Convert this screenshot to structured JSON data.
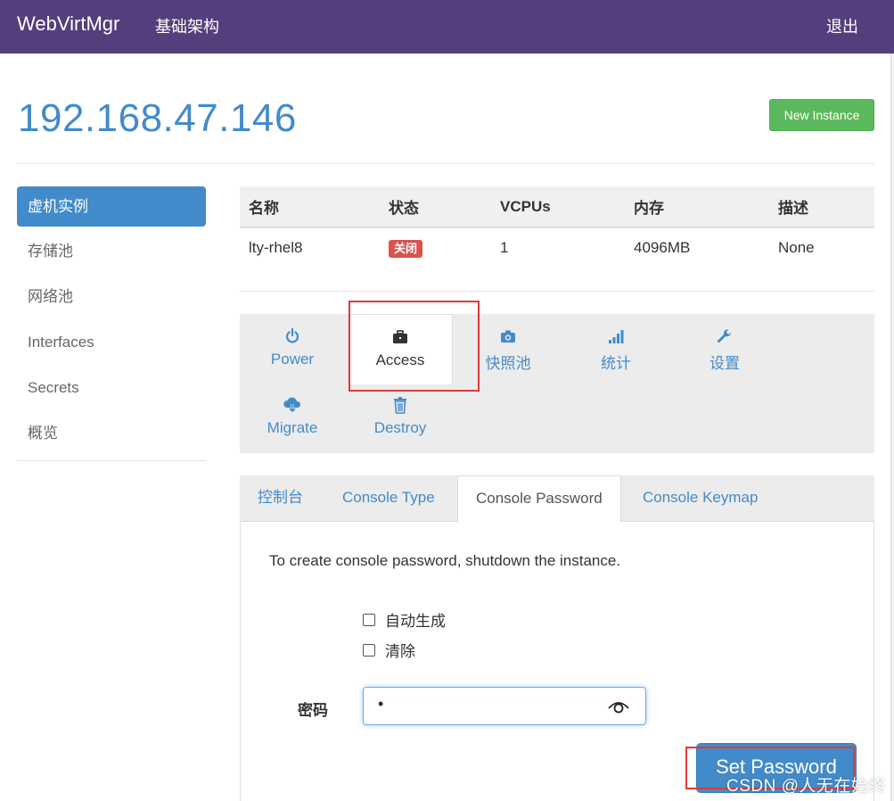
{
  "navbar": {
    "brand": "WebVirtMgr",
    "link": "基础架构",
    "logout": "退出",
    "bg_color": "#563d7c"
  },
  "header": {
    "title": "192.168.47.146",
    "new_instance_label": "New Instance"
  },
  "sidebar": {
    "items": [
      {
        "label": "虚机实例",
        "active": true
      },
      {
        "label": "存储池"
      },
      {
        "label": "网络池"
      },
      {
        "label": "Interfaces"
      },
      {
        "label": "Secrets"
      },
      {
        "label": "概览"
      }
    ]
  },
  "table": {
    "headers": [
      "名称",
      "状态",
      "VCPUs",
      "内存",
      "描述"
    ],
    "row": {
      "name": "lty-rhel8",
      "status": "关闭",
      "vcpus": "1",
      "memory": "4096MB",
      "desc": "None"
    }
  },
  "actions": [
    {
      "label": "Power",
      "icon": "power-icon"
    },
    {
      "label": "Access",
      "icon": "briefcase-icon",
      "selected": true
    },
    {
      "label": "快照池",
      "icon": "camera-icon"
    },
    {
      "label": "统计",
      "icon": "signal-icon"
    },
    {
      "label": "设置",
      "icon": "wrench-icon"
    },
    {
      "label": "Migrate",
      "icon": "cloud-download-icon"
    },
    {
      "label": "Destroy",
      "icon": "trash-icon"
    }
  ],
  "subtabs": [
    {
      "label": "控制台"
    },
    {
      "label": "Console Type"
    },
    {
      "label": "Console Password",
      "active": true
    },
    {
      "label": "Console Keymap"
    }
  ],
  "console_password": {
    "info": "To create console password, shutdown the instance.",
    "checkbox_auto": "自动生成",
    "checkbox_clear": "清除",
    "password_label": "密码",
    "password_value": "•",
    "submit_label": "Set Password"
  },
  "watermark": "CSDN @人无在始终",
  "colors": {
    "accent": "#428bca",
    "success": "#5cb85c",
    "danger": "#d9534f",
    "highlight": "#e03a3a"
  }
}
